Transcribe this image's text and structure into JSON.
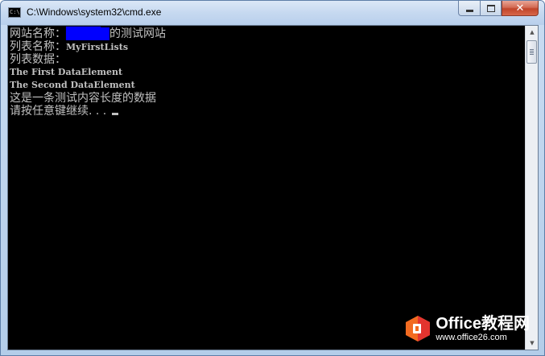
{
  "window": {
    "title": "C:\\Windows\\system32\\cmd.exe",
    "icon": "cmd-app-icon",
    "icon_text": "C:\\"
  },
  "caption_buttons": {
    "minimize_icon": "minimize-icon",
    "maximize_icon": "maximize-icon",
    "close_icon": "close-icon",
    "close_glyph": "✕"
  },
  "console": {
    "line1_prefix": "网站名称：",
    "line1_highlight": "████",
    "line1_suffix": "的测试网站",
    "line2_prefix": "列表名称：",
    "line2_value": "MyFirstLists",
    "line3": "列表数据：",
    "line4": "The First DataElement",
    "line5": "The Second DataElement",
    "line6": "这是一条测试内容长度的数据",
    "line7": "请按任意键继续. . . ",
    "colors": {
      "background": "#000000",
      "text": "#c0c0c0",
      "highlight": "#0000ff"
    }
  },
  "scrollbar": {
    "up_arrow": "▲",
    "down_arrow": "▼"
  },
  "watermark": {
    "brand": "Office教程网",
    "url": "www.office26.com",
    "colors": {
      "orange": "#f26b21",
      "red": "#e3342f"
    }
  }
}
